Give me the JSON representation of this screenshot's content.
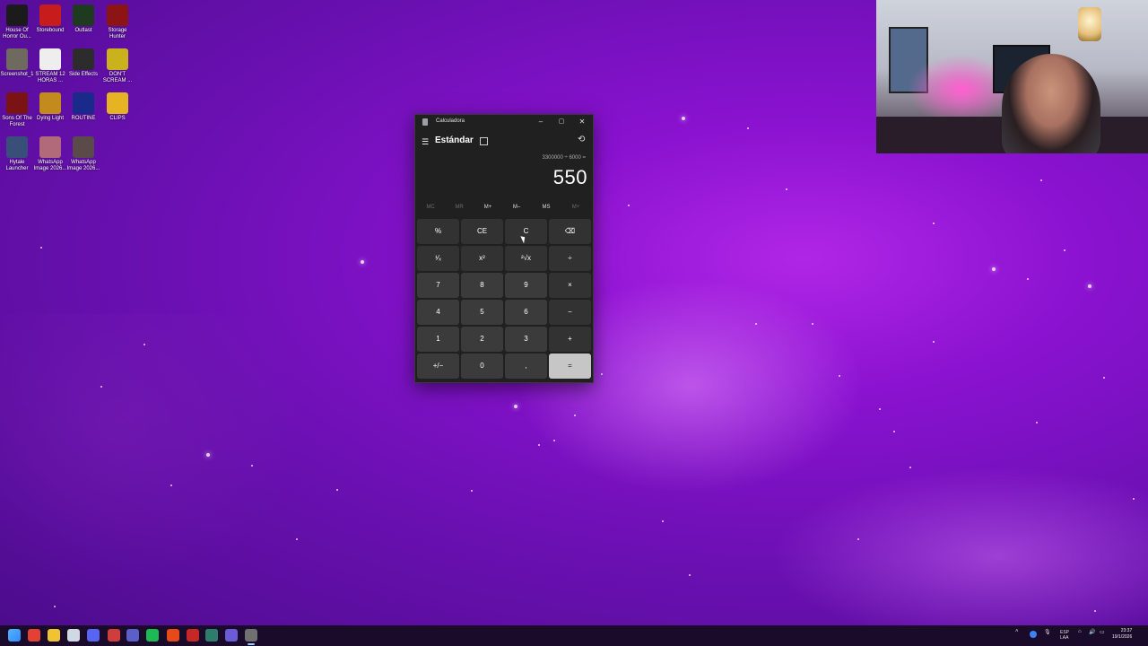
{
  "desktop": {
    "icons": [
      {
        "label": "House Of Horror Ou...",
        "icon": "house-of-horror-icon",
        "color": "#1b1b1b"
      },
      {
        "label": "Storebound",
        "icon": "storebound-icon",
        "color": "#c71c1c"
      },
      {
        "label": "Outlast",
        "icon": "outlast-icon",
        "color": "#1f3b1f"
      },
      {
        "label": "Storage Hunter",
        "icon": "storage-hunter-icon",
        "color": "#8d1414"
      },
      {
        "label": "Screenshot_1",
        "icon": "screenshot-icon",
        "color": "#6f6a60"
      },
      {
        "label": "STREAM 12 HORAS ...",
        "icon": "text-file-icon",
        "color": "#eeeeee"
      },
      {
        "label": "Side Effects",
        "icon": "side-effects-icon",
        "color": "#2c2c2c"
      },
      {
        "label": "DON'T SCREAM ...",
        "icon": "dont-scream-icon",
        "color": "#c9b21c"
      },
      {
        "label": "Sons Of The Forest",
        "icon": "sons-of-the-forest-icon",
        "color": "#7a1414"
      },
      {
        "label": "Dying Light",
        "icon": "dying-light-icon",
        "color": "#c38a1c"
      },
      {
        "label": "ROUTINE",
        "icon": "routine-icon",
        "color": "#1a2a8a"
      },
      {
        "label": "CLIPS",
        "icon": "folder-icon",
        "color": "#e6b422"
      },
      {
        "label": "Hytale Launcher",
        "icon": "hytale-launcher-icon",
        "color": "#3a4e7a"
      },
      {
        "label": "WhatsApp Image 2026...",
        "icon": "image-icon",
        "color": "#b06a7a"
      },
      {
        "label": "WhatsApp Image 2026...",
        "icon": "image-icon",
        "color": "#5a4a4a"
      }
    ]
  },
  "calculator": {
    "window_title": "Calculadora",
    "mode": "Estándar",
    "expression": "3300000 ÷ 6000 =",
    "result": "550",
    "window_buttons": {
      "minimize": "–",
      "maximize": "▢",
      "close": "✕"
    },
    "memory": [
      {
        "label": "MC",
        "enabled": false
      },
      {
        "label": "MR",
        "enabled": false
      },
      {
        "label": "M+",
        "enabled": true
      },
      {
        "label": "M–",
        "enabled": true
      },
      {
        "label": "MS",
        "enabled": true
      },
      {
        "label": "M˅",
        "enabled": false
      }
    ],
    "keys": [
      {
        "label": "%",
        "type": "fn",
        "name": "percent-key"
      },
      {
        "label": "CE",
        "type": "fn",
        "name": "clear-entry-key"
      },
      {
        "label": "C",
        "type": "fn",
        "name": "clear-key"
      },
      {
        "label": "⌫",
        "type": "fn",
        "name": "backspace-key"
      },
      {
        "label": "¹⁄ₓ",
        "type": "fn",
        "name": "reciprocal-key"
      },
      {
        "label": "x²",
        "type": "fn",
        "name": "square-key"
      },
      {
        "label": "²√x",
        "type": "fn",
        "name": "square-root-key"
      },
      {
        "label": "÷",
        "type": "fn",
        "name": "divide-key"
      },
      {
        "label": "7",
        "type": "num",
        "name": "key-7"
      },
      {
        "label": "8",
        "type": "num",
        "name": "key-8"
      },
      {
        "label": "9",
        "type": "num",
        "name": "key-9"
      },
      {
        "label": "×",
        "type": "fn",
        "name": "multiply-key"
      },
      {
        "label": "4",
        "type": "num",
        "name": "key-4"
      },
      {
        "label": "5",
        "type": "num",
        "name": "key-5"
      },
      {
        "label": "6",
        "type": "num",
        "name": "key-6"
      },
      {
        "label": "−",
        "type": "fn",
        "name": "subtract-key"
      },
      {
        "label": "1",
        "type": "num",
        "name": "key-1"
      },
      {
        "label": "2",
        "type": "num",
        "name": "key-2"
      },
      {
        "label": "3",
        "type": "num",
        "name": "key-3"
      },
      {
        "label": "+",
        "type": "fn",
        "name": "add-key"
      },
      {
        "label": "+/−",
        "type": "num",
        "name": "negate-key"
      },
      {
        "label": "0",
        "type": "num",
        "name": "key-0"
      },
      {
        "label": ",",
        "type": "num",
        "name": "decimal-key"
      },
      {
        "label": "=",
        "type": "eq",
        "name": "equals-key"
      }
    ]
  },
  "taskbar": {
    "apps": [
      {
        "icon": "windows-start-icon",
        "color": "#2f8cff"
      },
      {
        "icon": "chrome-icon",
        "color": "#e34133"
      },
      {
        "icon": "file-explorer-icon",
        "color": "#f1c232"
      },
      {
        "icon": "pen-app-icon",
        "color": "#cfd8e3"
      },
      {
        "icon": "discord-icon",
        "color": "#5865f2"
      },
      {
        "icon": "record-app-icon",
        "color": "#d03d3d"
      },
      {
        "icon": "teams-icon",
        "color": "#5b5fc7"
      },
      {
        "icon": "spotify-icon",
        "color": "#1db954"
      },
      {
        "icon": "media-app-icon",
        "color": "#e64a19"
      },
      {
        "icon": "calendar-app-icon",
        "color": "#c62828"
      },
      {
        "icon": "visual-studio-icon",
        "color": "#3d8bd0"
      },
      {
        "icon": "game-app-icon",
        "color": "#2e7d6b"
      },
      {
        "icon": "window-app-icon",
        "color": "#6c5bd6"
      },
      {
        "icon": "calculator-icon",
        "color": "#707070"
      }
    ],
    "tray": {
      "language": "ESP",
      "language2": "LAA",
      "time": "23:37",
      "date": "19/1/2026"
    }
  }
}
